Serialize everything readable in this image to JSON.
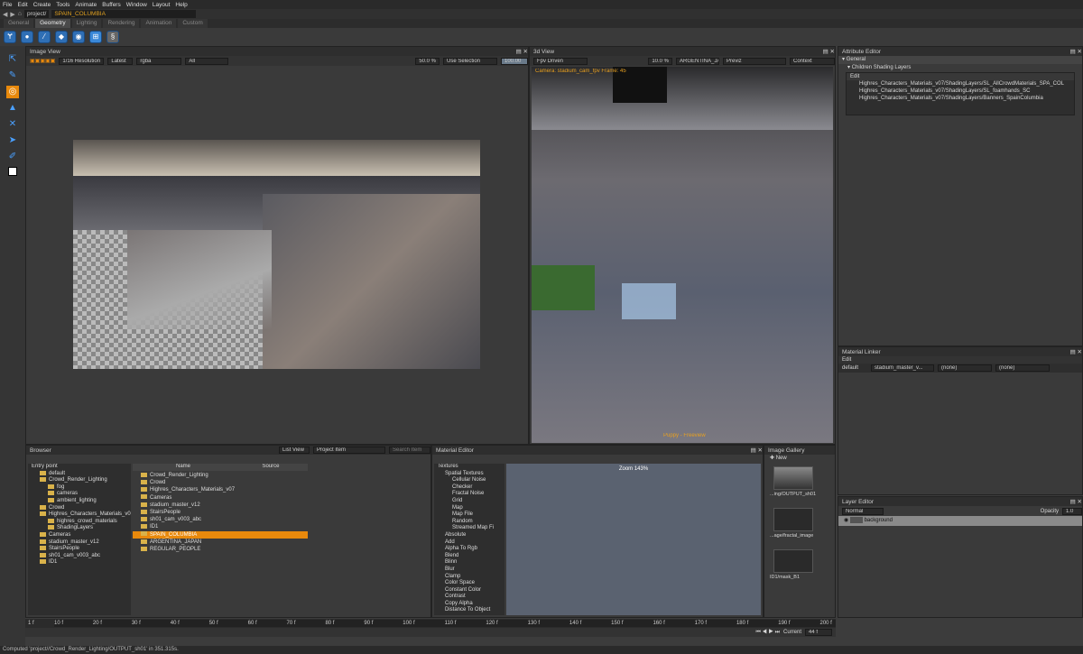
{
  "menu": [
    "File",
    "Edit",
    "Create",
    "Tools",
    "Animate",
    "Buffers",
    "Window",
    "Layout",
    "Help"
  ],
  "path": {
    "project": "project/",
    "selected": "SPAIN_COLUMBIA"
  },
  "tabs": [
    "General",
    "Geometry",
    "Lighting",
    "Rendering",
    "Animation",
    "Custom"
  ],
  "image_view": {
    "title": "Image View",
    "resolution": "1/16 Resolution",
    "version": "Latest",
    "channels": "rgba",
    "layer": "All",
    "zoom": "50.0 %",
    "selection": "Use Selection",
    "value": "100.00"
  },
  "view3d": {
    "title": "3d View",
    "camera": "Fpv Driven",
    "zoom": "10.0 %",
    "shot": "ARGENTINA_JAPA",
    "mode": "Previz",
    "context": "Context",
    "overlay_top": "Camera: stadium_cam_fpv  Frame: 45",
    "overlay_bottom": "Puppy - Freeview"
  },
  "attribute_editor": {
    "title": "Attribute Editor",
    "section": "General",
    "subsection": "Children Shading Layers",
    "edit": "Edit",
    "layers": [
      "Highres_Characters_Materials_v07/ShadingLayers/SL_AllCrowdMaterials_SPA_COL",
      "Highres_Characters_Materials_v07/ShadingLayers/SL_foamhands_SC",
      "Highres_Characters_Materials_v07/ShadingLayers/Banners_SpainColumbia"
    ]
  },
  "material_linker": {
    "title": "Material Linker",
    "edit": "Edit",
    "row": {
      "name": "default",
      "material": "stadium_master_v...",
      "slot1": "(none)",
      "slot2": "(none)"
    }
  },
  "browser": {
    "title": "Browser",
    "list_view": "List View",
    "project_item": "Project Item",
    "search": "Search Item",
    "tree": [
      {
        "label": "Entry point",
        "indent": 0,
        "folder": false
      },
      {
        "label": "default",
        "indent": 1,
        "folder": true
      },
      {
        "label": "Crowd_Render_Lighting",
        "indent": 1,
        "folder": true
      },
      {
        "label": "fog",
        "indent": 2,
        "folder": true
      },
      {
        "label": "cameras",
        "indent": 2,
        "folder": true
      },
      {
        "label": "ambient_lighting",
        "indent": 2,
        "folder": true
      },
      {
        "label": "Crowd",
        "indent": 1,
        "folder": true
      },
      {
        "label": "Highres_Characters_Materials_v07",
        "indent": 1,
        "folder": true
      },
      {
        "label": "highres_crowd_materials",
        "indent": 2,
        "folder": true
      },
      {
        "label": "ShadingLayers",
        "indent": 2,
        "folder": true
      },
      {
        "label": "Cameras",
        "indent": 1,
        "folder": true
      },
      {
        "label": "stadium_master_v12",
        "indent": 1,
        "folder": true
      },
      {
        "label": "StairsPeople",
        "indent": 1,
        "folder": true
      },
      {
        "label": "sh01_cam_v003_abc",
        "indent": 1,
        "folder": true
      },
      {
        "label": "ID1",
        "indent": 1,
        "folder": true
      }
    ],
    "columns": [
      "Name",
      "Source"
    ],
    "items": [
      {
        "label": "Crowd_Render_Lighting",
        "selected": false
      },
      {
        "label": "Crowd",
        "selected": false
      },
      {
        "label": "Highres_Characters_Materials_v07",
        "selected": false
      },
      {
        "label": "Cameras",
        "selected": false
      },
      {
        "label": "stadium_master_v12",
        "selected": false
      },
      {
        "label": "StairsPeople",
        "selected": false
      },
      {
        "label": "sh01_cam_v003_abc",
        "selected": false
      },
      {
        "label": "ID1",
        "selected": false
      },
      {
        "label": "SPAIN_COLUMBIA",
        "selected": true
      },
      {
        "label": "ARGENTINA_JAPAN",
        "selected": false
      },
      {
        "label": "REGULAR_PEOPLE",
        "selected": false
      }
    ]
  },
  "material_editor": {
    "title": "Material Editor",
    "zoom": "Zoom 143%",
    "nodes": [
      {
        "label": "Textures",
        "indent": 0
      },
      {
        "label": "Spatial Textures",
        "indent": 1
      },
      {
        "label": "Cellular Noise",
        "indent": 2
      },
      {
        "label": "Checker",
        "indent": 2
      },
      {
        "label": "Fractal Noise",
        "indent": 2
      },
      {
        "label": "Grid",
        "indent": 2
      },
      {
        "label": "Map",
        "indent": 2
      },
      {
        "label": "Map File",
        "indent": 2
      },
      {
        "label": "Random",
        "indent": 2
      },
      {
        "label": "Streamed Map Fi",
        "indent": 2
      },
      {
        "label": "Absolute",
        "indent": 1
      },
      {
        "label": "Add",
        "indent": 1
      },
      {
        "label": "Alpha To Rgb",
        "indent": 1
      },
      {
        "label": "Blend",
        "indent": 1
      },
      {
        "label": "Blinn",
        "indent": 1
      },
      {
        "label": "Blur",
        "indent": 1
      },
      {
        "label": "Clamp",
        "indent": 1
      },
      {
        "label": "Color Space",
        "indent": 1
      },
      {
        "label": "Constant Color",
        "indent": 1
      },
      {
        "label": "Contrast",
        "indent": 1
      },
      {
        "label": "Copy Alpha",
        "indent": 1
      },
      {
        "label": "Distance To Object",
        "indent": 1
      }
    ]
  },
  "image_gallery": {
    "title": "Image Gallery",
    "new": "New",
    "items": [
      "...ing/OUTPUT_sh01",
      "...age/fractal_image",
      "ID1/mask_B1"
    ]
  },
  "layer_editor": {
    "title": "Layer Editor",
    "blend": "Normal",
    "opacity_label": "Opacity",
    "opacity": "1.0",
    "layer": "background"
  },
  "timeline": {
    "start": "1 f",
    "ticks": [
      "10 f",
      "20 f",
      "30 f",
      "40 f",
      "50 f",
      "60 f",
      "70 f",
      "80 f",
      "90 f",
      "100 f",
      "110 f",
      "120 f",
      "130 f",
      "140 f",
      "150 f",
      "160 f",
      "170 f",
      "180 f",
      "190 f",
      "200 f"
    ],
    "end": "200 f",
    "current_label": "Current",
    "current": "44 f"
  },
  "status": "Computed 'project//Crowd_Render_Lighting/OUTPUT_sh01' in 351.315s."
}
